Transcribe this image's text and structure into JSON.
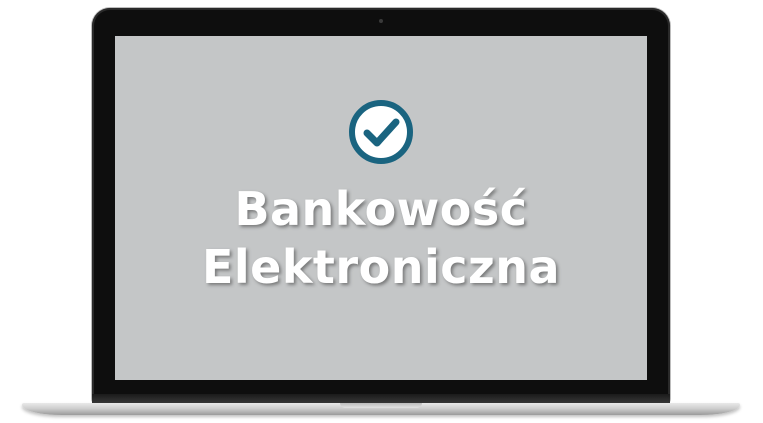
{
  "screen": {
    "icon": "check-circle-icon",
    "title_line1": "Bankowość",
    "title_line2": "Elektroniczna"
  },
  "colors": {
    "screen_bg": "#c4c6c7",
    "icon_color": "#1a6480",
    "text_color": "#ffffff",
    "bezel": "#0e0e0e"
  }
}
